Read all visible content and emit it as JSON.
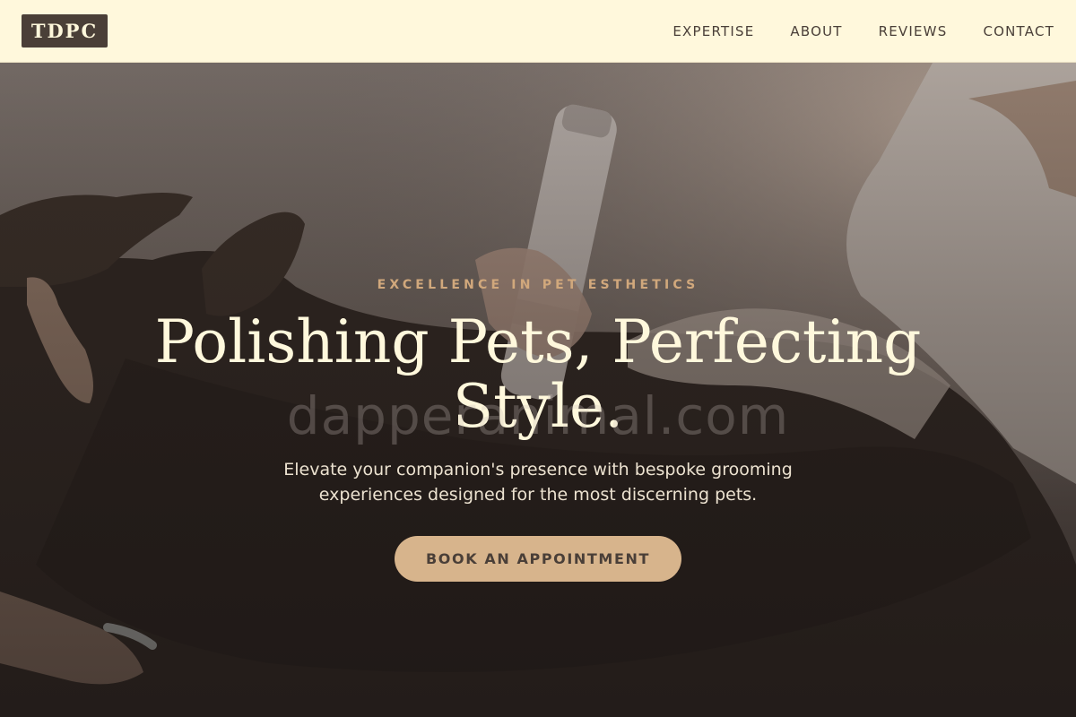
{
  "header": {
    "logo_text": "TDPC",
    "nav": [
      {
        "label": "EXPERTISE"
      },
      {
        "label": "ABOUT"
      },
      {
        "label": "REVIEWS"
      },
      {
        "label": "CONTACT"
      }
    ]
  },
  "hero": {
    "eyebrow": "EXCELLENCE IN PET ESTHETICS",
    "headline": "Polishing Pets, Perfecting Style.",
    "watermark": "dapperanimal.com",
    "subtext": "Elevate your companion's presence with bespoke grooming experiences designed for the most discerning pets.",
    "cta_label": "BOOK AN APPOINTMENT"
  },
  "colors": {
    "header_bg": "#fff8dc",
    "logo_bg": "#4a3f38",
    "accent": "#d7b48c",
    "eyebrow": "#d1a87c",
    "headline": "#fff8dc"
  },
  "icons": [
    "hero-photo-dog-paws-grooming"
  ]
}
